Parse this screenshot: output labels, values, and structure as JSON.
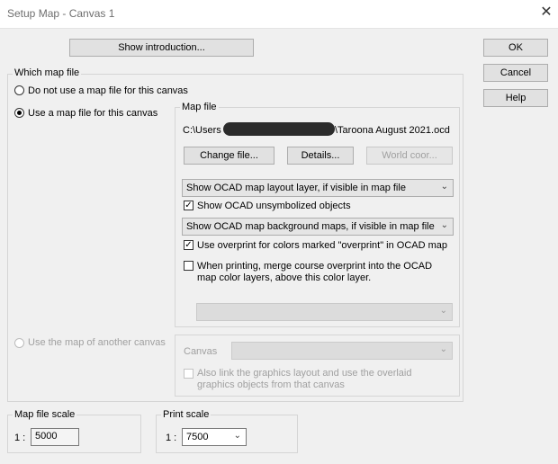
{
  "window": {
    "title": "Setup Map - Canvas 1",
    "close_glyph": "✕"
  },
  "buttons": {
    "intro": "Show introduction...",
    "ok": "OK",
    "cancel": "Cancel",
    "help": "Help",
    "change_file": "Change file...",
    "details": "Details...",
    "world_coord": "World coor..."
  },
  "which_map": {
    "label": "Which map file",
    "opt_none": "Do not use a map file for this canvas",
    "opt_use": "Use a map file for this canvas",
    "opt_other": "Use the map of another canvas",
    "selected": "opt_use"
  },
  "map_file": {
    "label": "Map file",
    "path_prefix": "C:\\Users",
    "path_suffix": "\\Taroona August 2021.ocd",
    "layout_combo": "Show OCAD map layout layer, if visible in map file",
    "unsymbolized": {
      "label": "Show OCAD unsymbolized objects",
      "checked": true
    },
    "background_combo": "Show OCAD map background maps, if visible in map file",
    "overprint": {
      "label": "Use overprint for colors marked \"overprint\" in OCAD map",
      "checked": true
    },
    "merge": {
      "line1": "When printing, merge course overprint into the OCAD",
      "line2": "map color layers, above this color layer.",
      "checked": false
    }
  },
  "other_canvas": {
    "canvas_label": "Canvas",
    "link": {
      "line1": "Also link the graphics layout and use the overlaid",
      "line2": "graphics objects from that canvas",
      "checked": false
    }
  },
  "scales": {
    "map_label": "Map file scale",
    "map_prefix": "1 :",
    "map_value": "5000",
    "print_label": "Print scale",
    "print_prefix": "1 :",
    "print_value": "7500"
  },
  "icons": {
    "dropdown": "chevron-down-icon",
    "check": "checkmark-icon"
  }
}
